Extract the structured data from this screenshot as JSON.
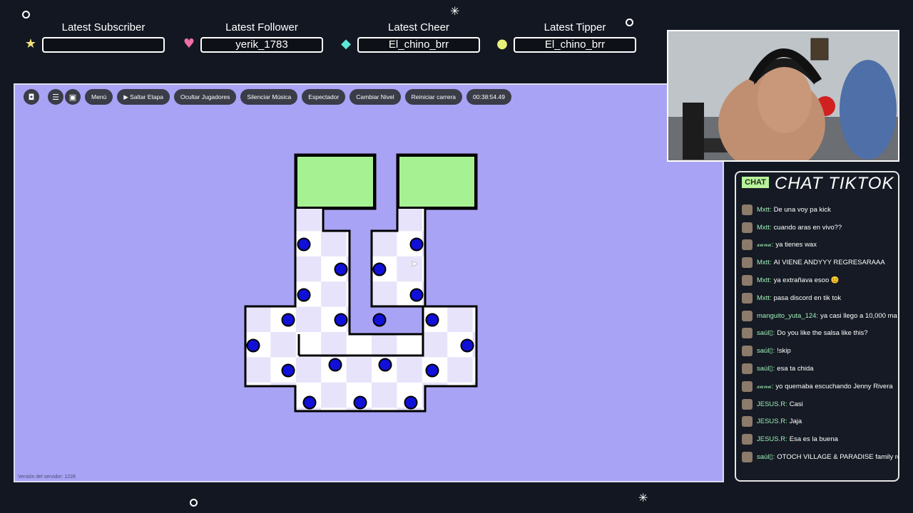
{
  "alerts": [
    {
      "title": "Latest Subscriber",
      "value": "",
      "icon": "star-icon",
      "icon_color": "#f3e27a"
    },
    {
      "title": "Latest Follower",
      "value": "yerik_1783",
      "icon": "heart-icon",
      "icon_color": "#ee6fa8"
    },
    {
      "title": "Latest Cheer",
      "value": "El_chino_brr",
      "icon": "diamond-icon",
      "icon_color": "#5ae8d6"
    },
    {
      "title": "Latest Tipper",
      "value": "El_chino_brr",
      "icon": "coin-icon",
      "icon_color": "#e9f07a"
    }
  ],
  "toolbar": {
    "menu": "Menú",
    "skip_stage": "Saltar Etapa",
    "hide_players": "Ocultar Jugadores",
    "mute_music": "Silenciar Música",
    "spectator": "Espectador",
    "change_level": "Cambiar Nivel",
    "restart_race": "Reiniciar carrera",
    "timer": "00:38:54.49"
  },
  "server_version": "Versión del servidor: 1228",
  "colors": {
    "game_bg": "#a9a3f5",
    "safe_zone": "#a6f293",
    "enemy_dot": "#1010d8",
    "checker_light": "#ffffff",
    "checker_dark": "#e6e3fa",
    "chat_name": "#9ef0b6",
    "chat_badge": "#b8f29a"
  },
  "chat": {
    "badge": "CHAT",
    "title": "CHAT TIKTOK",
    "messages": [
      {
        "user": "Mxtt:",
        "text": "De una voy pa kick"
      },
      {
        "user": "Mxtt:",
        "text": "cuando aras en vivo??"
      },
      {
        "user": "𝓍𝒶𝓃𝒶:",
        "text": "ya tienes wax"
      },
      {
        "user": "Mxtt:",
        "text": "AI VIENE ANDYYY REGRESARAAA"
      },
      {
        "user": "Mxtt:",
        "text": "ya extrañava esoo 😊"
      },
      {
        "user": "Mxtt:",
        "text": "pasa discord en tik tok"
      },
      {
        "user": "manguito_yuta_124:",
        "text": "ya casi llego a 10,000 ma"
      },
      {
        "user": "saúl▯:",
        "text": "Do you like the salsa like this?"
      },
      {
        "user": "saúl▯:",
        "text": "!skip"
      },
      {
        "user": "saúl▯:",
        "text": "esa ta chida"
      },
      {
        "user": "𝓍𝒶𝓃𝒶:",
        "text": "yo quemaba escuchando Jenny Rivera"
      },
      {
        "user": "JESUS.R:",
        "text": "Casi"
      },
      {
        "user": "JESUS.R:",
        "text": "Jaja"
      },
      {
        "user": "JESUS.R:",
        "text": "Esa es la buena"
      },
      {
        "user": "saúl▯:",
        "text": "OTOCH VILLAGE & PARADISE family res"
      }
    ]
  }
}
